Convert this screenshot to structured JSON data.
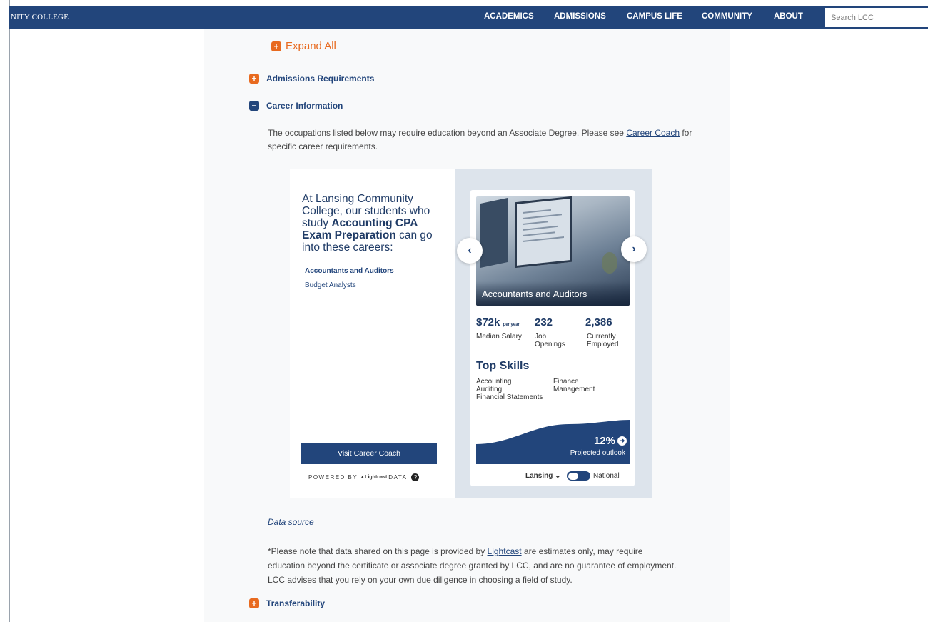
{
  "header": {
    "brand": "NITY COLLEGE",
    "nav": [
      "ACADEMICS",
      "ADMISSIONS",
      "CAMPUS LIFE",
      "COMMUNITY",
      "ABOUT"
    ],
    "search_placeholder": "Search LCC"
  },
  "accordion": {
    "expand_all": "Expand All",
    "admissions": "Admissions Requirements",
    "career": "Career Information",
    "transferability": "Transferability"
  },
  "career_info": {
    "text_before": "The occupations listed below may require education beyond an Associate Degree. Please see ",
    "link": "Career Coach",
    "text_after": " for specific career requirements."
  },
  "widget": {
    "intro_1": "At Lansing Community College, our students who study ",
    "intro_program": "Accounting CPA Exam Preparation",
    "intro_2": " can go into these careers:",
    "careers": [
      "Accountants and Auditors",
      "Budget Analysts"
    ],
    "visit_button": "Visit Career Coach",
    "powered_by": "POWERED BY",
    "lightcast": "Lightcast",
    "data_word": "DATA",
    "card": {
      "title": "Accountants and Auditors",
      "salary": "$72k",
      "salary_unit": "per year",
      "salary_label": "Median Salary",
      "openings": "232",
      "openings_label": "Job Openings",
      "employed": "2,386",
      "employed_label": "Currently Employed",
      "top_skills": "Top Skills",
      "skills": [
        "Accounting",
        "Auditing",
        "Financial Statements",
        "Finance Management"
      ],
      "outlook_pct": "12%",
      "outlook_label": "Projected outlook",
      "location": "Lansing",
      "national": "National"
    }
  },
  "data_source": "Data source",
  "note": {
    "before": "*Please note that data shared on this page is provided by ",
    "link": "Lightcast",
    "after": " are estimates only, may require education beyond the certificate or associate degree granted by LCC, and are no guarantee of employment. LCC advises that you rely on your own due diligence in choosing a field of study."
  }
}
